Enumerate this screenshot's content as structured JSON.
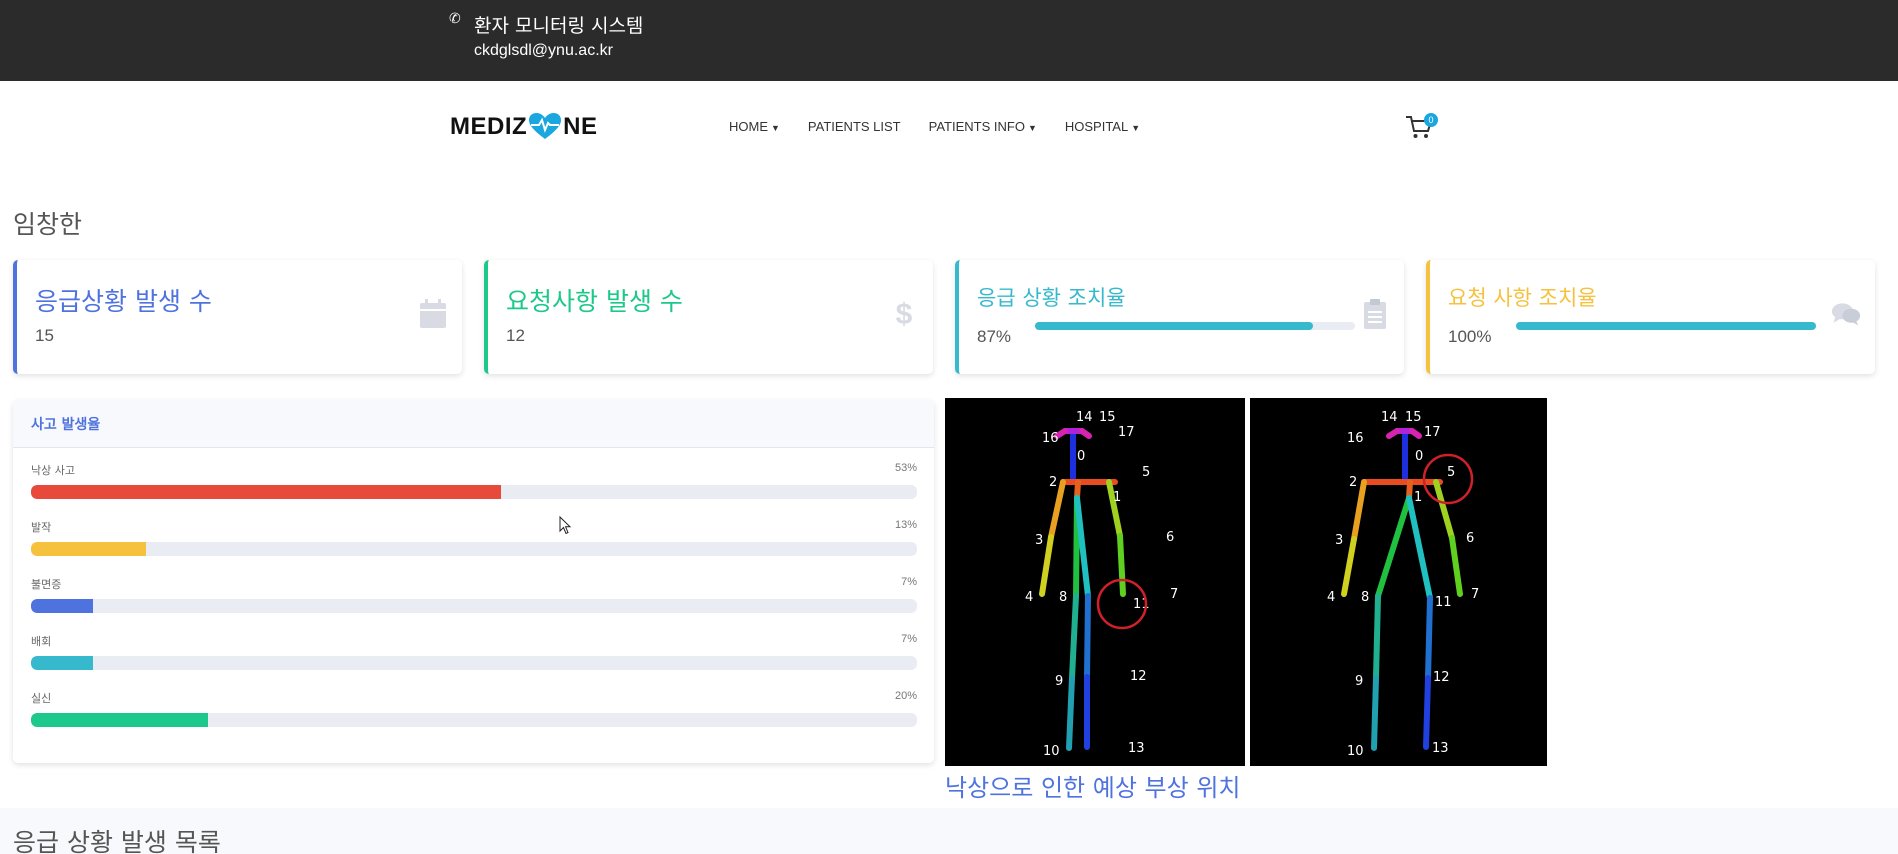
{
  "topbar": {
    "phone_icon": "phone-icon",
    "system_name": "환자 모니터링 시스템",
    "email": "ckdglsdl@ynu.ac.kr"
  },
  "nav": {
    "logo_left": "MEDIZ",
    "logo_right": "NE",
    "logo_icon": "heart-pulse-icon",
    "menu": [
      {
        "label": "HOME",
        "dropdown": true
      },
      {
        "label": "PATIENTS LIST",
        "dropdown": false
      },
      {
        "label": "PATIENTS INFO",
        "dropdown": true
      },
      {
        "label": "HOSPITAL",
        "dropdown": true
      }
    ],
    "cart_icon": "cart-icon",
    "cart_count": "0"
  },
  "patient_name": "임창한",
  "stats": {
    "emergency_count": {
      "title": "응급상황 발생 수",
      "value": "15",
      "icon": "calendar-icon",
      "color": "#4e73df"
    },
    "request_count": {
      "title": "요청사항 발생 수",
      "value": "12",
      "icon": "dollar-icon",
      "color": "#1cc88a"
    },
    "emergency_rate": {
      "title": "응급 상황 조치율",
      "value": "87%",
      "progress": 0.87,
      "icon": "clipboard-icon",
      "color": "#36b9cc"
    },
    "request_rate": {
      "title": "요청 사항 조치율",
      "value": "100%",
      "progress": 1.0,
      "icon": "comments-icon",
      "color": "#f6c23e"
    }
  },
  "accident_panel": {
    "title": "사고 발생율",
    "rows": [
      {
        "label": "낙상 사고",
        "percent": "53%",
        "value": 0.53,
        "color": "#e74a3b"
      },
      {
        "label": "발작",
        "percent": "13%",
        "value": 0.13,
        "color": "#f6c23e"
      },
      {
        "label": "불면증",
        "percent": "7%",
        "value": 0.07,
        "color": "#4e73df"
      },
      {
        "label": "배회",
        "percent": "7%",
        "value": 0.07,
        "color": "#36b9cc"
      },
      {
        "label": "실신",
        "percent": "20%",
        "value": 0.2,
        "color": "#1cc88a"
      }
    ]
  },
  "skeleton_labels": {
    "k0": "0",
    "k1": "1",
    "k2": "2",
    "k3": "3",
    "k4": "4",
    "k5": "5",
    "k6": "6",
    "k7": "7",
    "k8": "8",
    "k9": "9",
    "k10": "10",
    "k11": "11",
    "k12": "12",
    "k13": "13",
    "k14": "14",
    "k15": "15",
    "k16": "16",
    "k17": "17"
  },
  "caption": "낙상으로 인한 예상 부상 위치",
  "emergency_list_title": "응급 상황 발생 목록"
}
